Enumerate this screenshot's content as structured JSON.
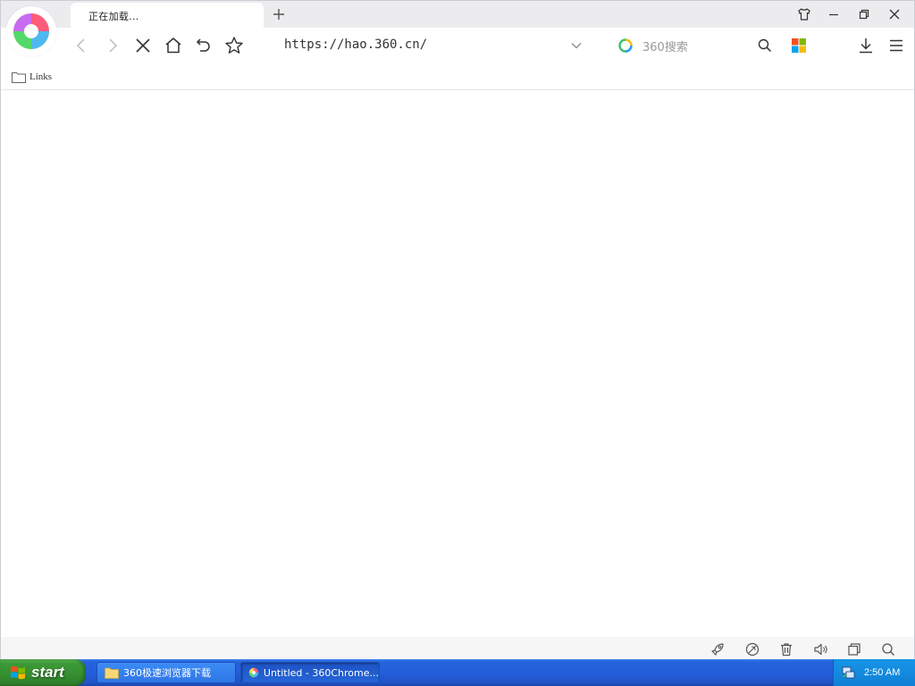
{
  "browser": {
    "tab": {
      "title": "正在加载..."
    },
    "toolbar": {
      "url": "https://hao.360.cn/",
      "search_label": "360搜索"
    },
    "bookmarks": [
      {
        "label": "Links"
      }
    ]
  },
  "taskbar": {
    "start_label": "start",
    "tasks": [
      {
        "label": "360极速浏览器下载",
        "icon": "folder-icon"
      },
      {
        "label": "Untitled - 360Chrome...",
        "icon": "browser-icon"
      }
    ],
    "clock": "2:50 AM"
  },
  "colors": {
    "taskbar_blue": "#245edb",
    "start_green": "#3c9a37",
    "tray_blue": "#0f7fd4"
  }
}
